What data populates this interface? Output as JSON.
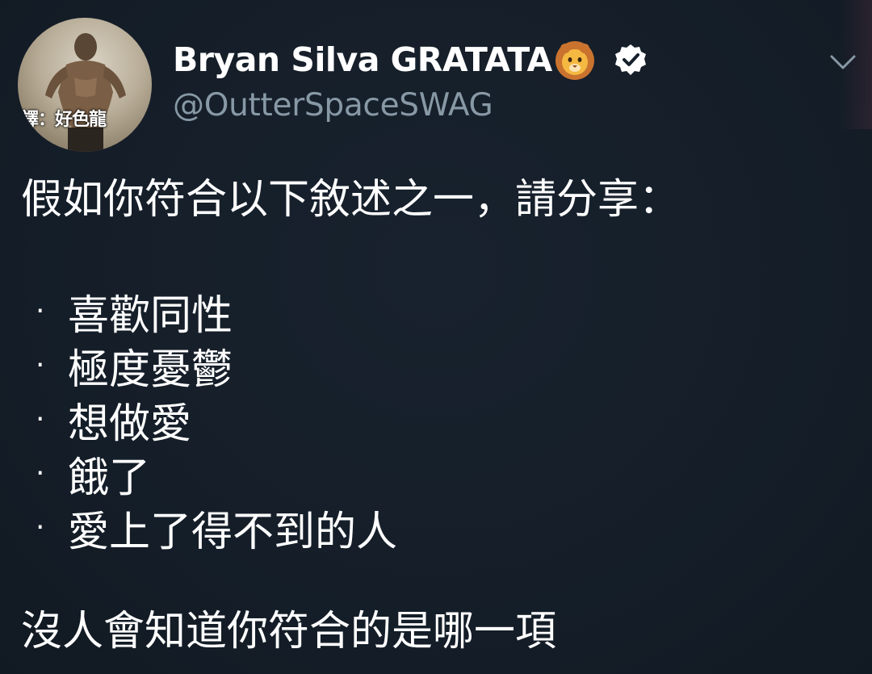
{
  "author": {
    "display_name": "Bryan Silva GRATATA",
    "handle": "@OutterSpaceSWAG",
    "avatar_caption": "譯：好色龍",
    "name_emoji": "lion-face-emoji",
    "verified_badge": "verified-icon"
  },
  "menu": {
    "icon": "chevron-down-icon"
  },
  "tweet": {
    "intro": "假如你符合以下敘述之一，請分享：",
    "bullet_symbol": "·",
    "items": [
      {
        "label": "喜歡同性"
      },
      {
        "label": "極度憂鬱"
      },
      {
        "label": "想做愛"
      },
      {
        "label": "餓了"
      },
      {
        "label": "愛上了得不到的人"
      }
    ],
    "outro": "沒人會知道你符合的是哪一項"
  },
  "colors": {
    "background": "#15202b",
    "text": "#ffffff",
    "secondary_text": "#8899a6"
  }
}
